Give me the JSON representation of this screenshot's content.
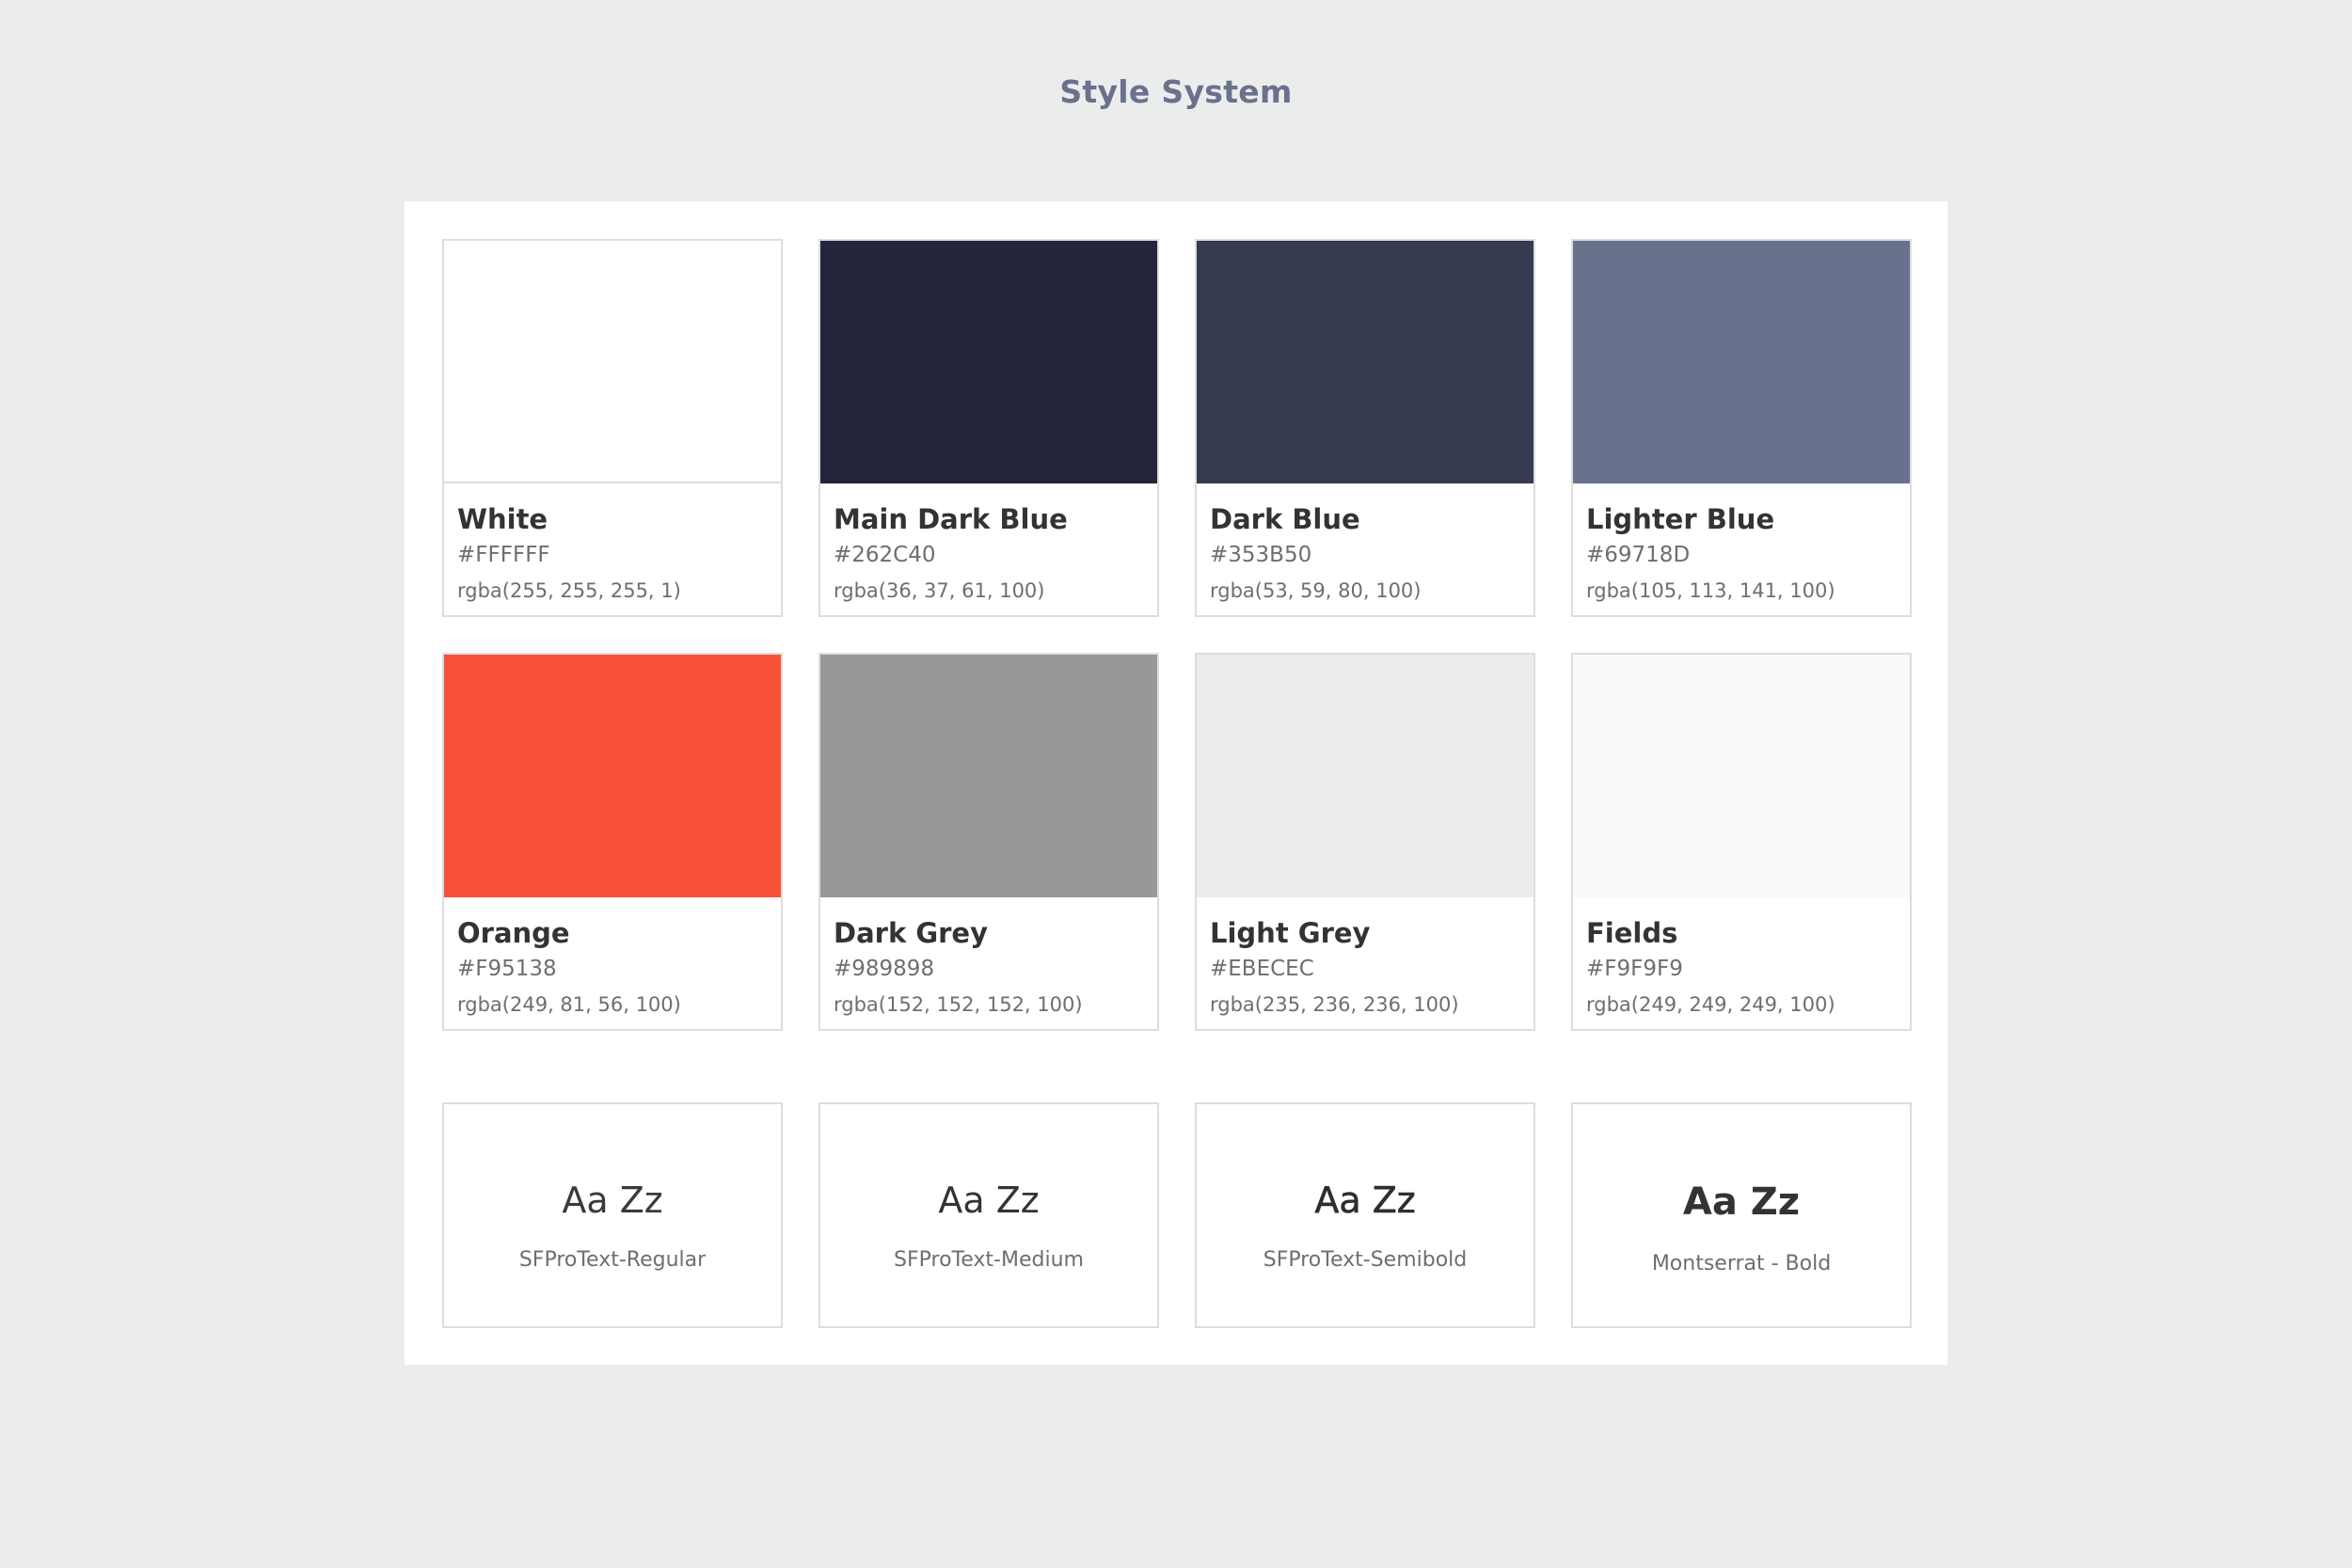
{
  "page": {
    "title": "Style System"
  },
  "colors": [
    {
      "name": "White",
      "hex_label": "#FFFFFF",
      "rgba_label": "rgba(255, 255, 255, 1)",
      "swatch": "#FFFFFF"
    },
    {
      "name": "Main Dark Blue",
      "hex_label": "#262C40",
      "rgba_label": "rgba(36, 37, 61, 100)",
      "swatch": "#24253D"
    },
    {
      "name": "Dark Blue",
      "hex_label": "#353B50",
      "rgba_label": "rgba(53, 59, 80, 100)",
      "swatch": "#353B50"
    },
    {
      "name": "Lighter Blue",
      "hex_label": "#69718D",
      "rgba_label": "rgba(105, 113, 141, 100)",
      "swatch": "#69718D"
    },
    {
      "name": "Orange",
      "hex_label": "#F95138",
      "rgba_label": "rgba(249, 81, 56, 100)",
      "swatch": "#F95138"
    },
    {
      "name": "Dark Grey",
      "hex_label": "#989898",
      "rgba_label": "rgba(152, 152, 152, 100)",
      "swatch": "#989898"
    },
    {
      "name": "Light Grey",
      "hex_label": "#EBECEC",
      "rgba_label": "rgba(235, 236, 236, 100)",
      "swatch": "#EBECEC"
    },
    {
      "name": "Fields",
      "hex_label": "#F9F9F9",
      "rgba_label": "rgba(249, 249, 249, 100)",
      "swatch": "#F9F9F9"
    }
  ],
  "typography": [
    {
      "sample": "Aa Zz",
      "font_label": "SFProText-Regular"
    },
    {
      "sample": "Aa Zz",
      "font_label": "SFProText-Medium"
    },
    {
      "sample": "Aa Zz",
      "font_label": "SFProText-Semibold"
    },
    {
      "sample": "Aa Zz",
      "font_label": "Montserrat - Bold"
    }
  ]
}
